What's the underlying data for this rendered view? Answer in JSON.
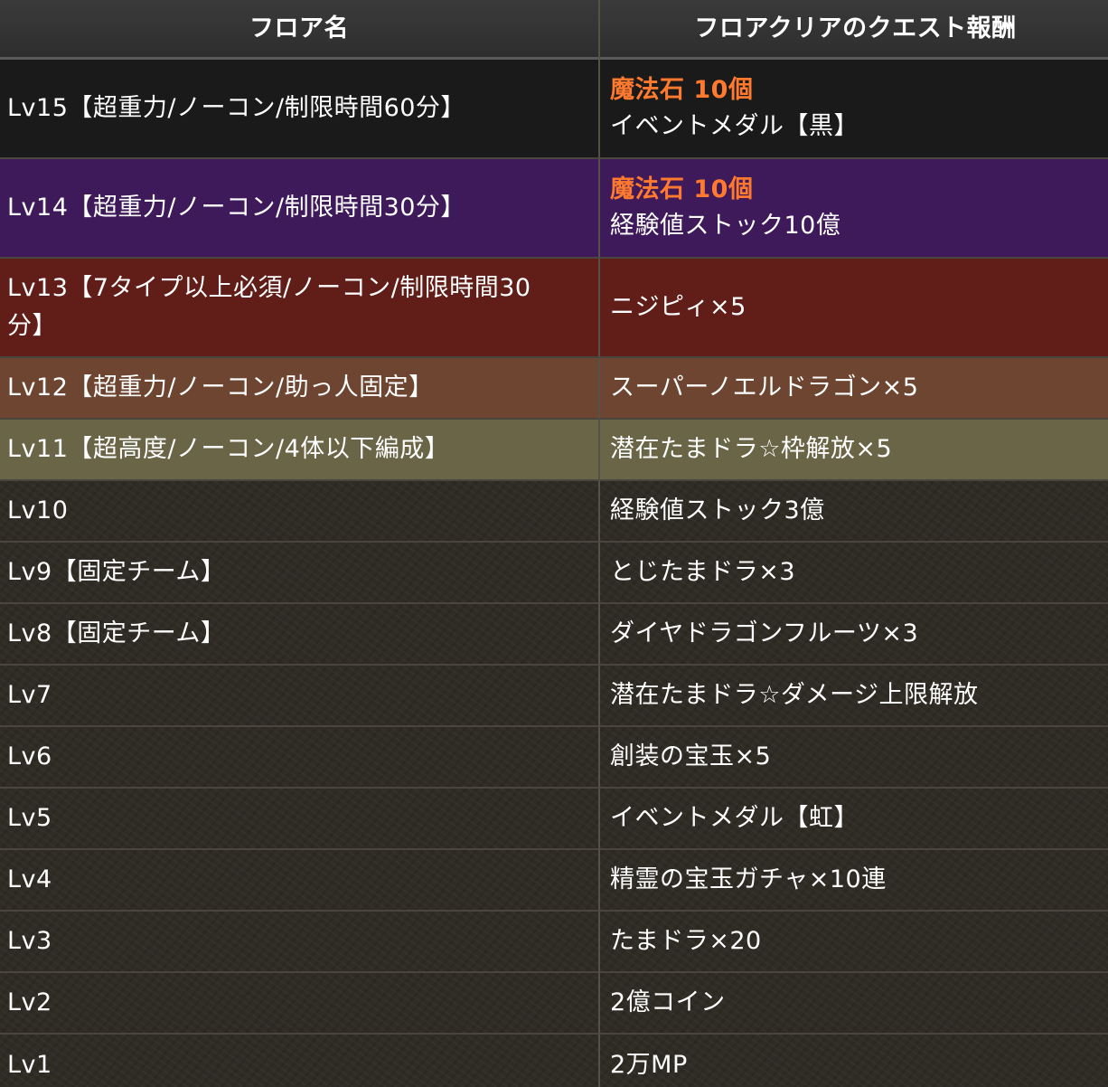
{
  "header": {
    "col_floor": "フロア名",
    "col_reward": "フロアクリアのクエスト報酬"
  },
  "rows": [
    {
      "floor": "Lv15【超重力/ノーコン/制限時間60分】",
      "highlight": "魔法石 10個",
      "reward": "イベントメダル【黒】"
    },
    {
      "floor": "Lv14【超重力/ノーコン/制限時間30分】",
      "highlight": "魔法石 10個",
      "reward": "経験値ストック10億"
    },
    {
      "floor": "Lv13【7タイプ以上必須/ノーコン/制限時間30分】",
      "reward": "ニジピィ×5"
    },
    {
      "floor": "Lv12【超重力/ノーコン/助っ人固定】",
      "reward": "スーパーノエルドラゴン×5"
    },
    {
      "floor": "Lv11【超高度/ノーコン/4体以下編成】",
      "reward": "潜在たまドラ☆枠解放×5"
    },
    {
      "floor": "Lv10",
      "reward": "経験値ストック3億"
    },
    {
      "floor": "Lv9【固定チーム】",
      "reward": "とじたまドラ×3"
    },
    {
      "floor": "Lv8【固定チーム】",
      "reward": "ダイヤドラゴンフルーツ×3"
    },
    {
      "floor": "Lv7",
      "reward": "潜在たまドラ☆ダメージ上限解放"
    },
    {
      "floor": "Lv6",
      "reward": "創装の宝玉×5"
    },
    {
      "floor": "Lv5",
      "reward": "イベントメダル【虹】"
    },
    {
      "floor": "Lv4",
      "reward": "精霊の宝玉ガチャ×10連"
    },
    {
      "floor": "Lv3",
      "reward": "たまドラ×20"
    },
    {
      "floor": "Lv2",
      "reward": "2億コイン"
    },
    {
      "floor": "Lv1",
      "reward": "2万MP"
    }
  ],
  "colors": {
    "highlight": "#ff7a2e",
    "row_lv15": "#1a1a1a",
    "row_lv14": "#3f1a5a",
    "row_lv13": "#611e19",
    "row_lv12": "#6d4530",
    "row_lv11": "#6b6547"
  }
}
